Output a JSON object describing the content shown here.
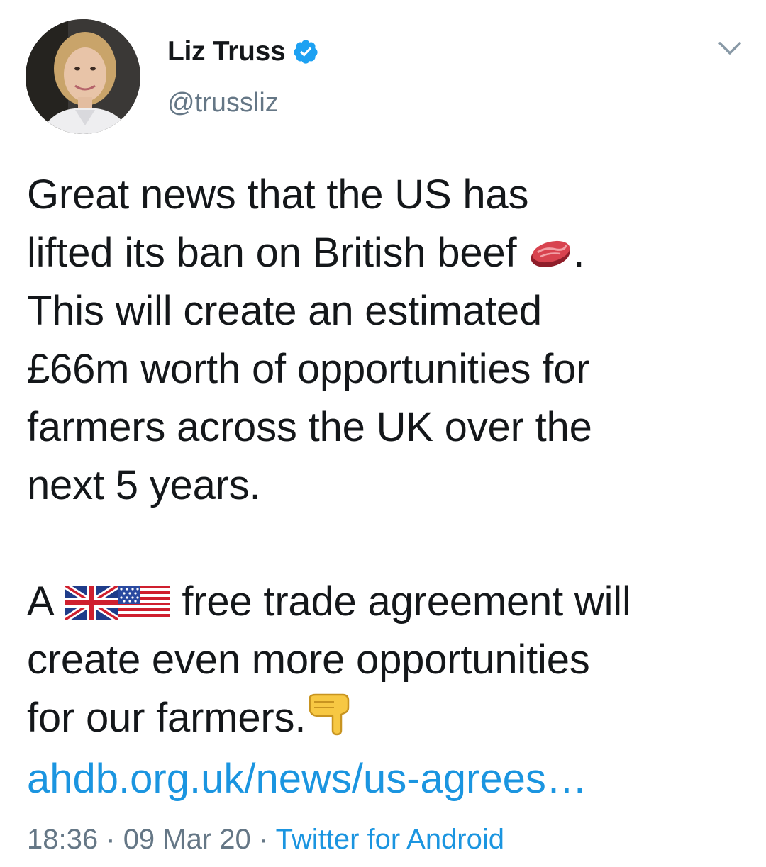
{
  "author": {
    "display_name": "Liz Truss",
    "handle": "@trussliz",
    "verified": true
  },
  "tweet": {
    "lines_p1": [
      "Great news that the US has",
      "lifted its ban on British beef",
      "This will create an estimated",
      "£66m worth of opportunities for",
      "farmers across the UK over the",
      "next 5 years."
    ],
    "beef_line_suffix": ".",
    "p2_line1_prefix": "A",
    "p2_line1_suffix": "free trade agreement will",
    "p2_line2": "create even more opportunities",
    "p2_line3": "for our farmers.",
    "link_text": "ahdb.org.uk/news/us-agrees…",
    "emojis": [
      "cut-of-meat",
      "uk-flag",
      "us-flag",
      "backhand-index-pointing-down"
    ]
  },
  "meta": {
    "time": "18:36",
    "separator": "·",
    "date": "09 Mar 20",
    "source": "Twitter for Android"
  },
  "colors": {
    "text": "#14171a",
    "secondary": "#657786",
    "link": "#1b95e0",
    "verified": "#1da1f2"
  }
}
